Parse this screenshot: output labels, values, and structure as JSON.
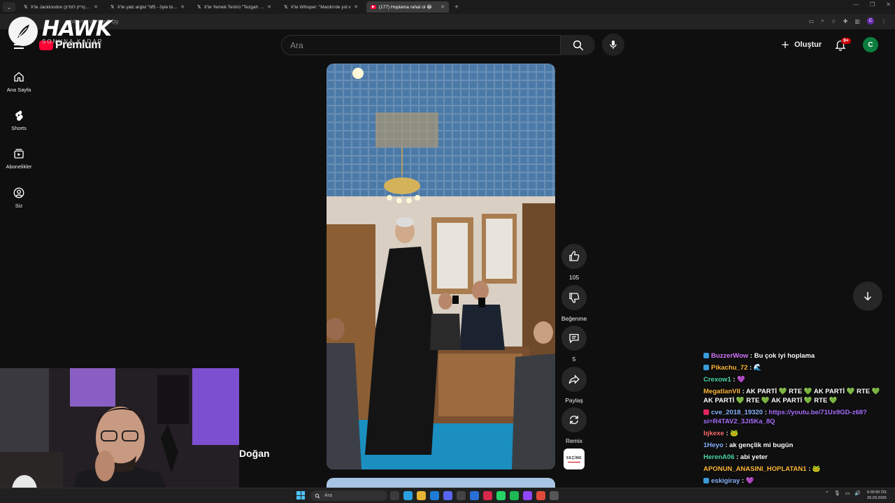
{
  "browser": {
    "tabs": [
      {
        "icon": "x-icon",
        "title": "X'te Jacklondon (גייק לונדון) \"Xag",
        "active": false
      },
      {
        "icon": "x-icon",
        "title": "X'te yalc argivi \"bf5 - öyle bi an",
        "active": false
      },
      {
        "icon": "x-icon",
        "title": "X'te Yemek Terörü \"Tezgah ter",
        "active": false
      },
      {
        "icon": "x-icon",
        "title": "X'te Whisper: \"Mardin'de yol v",
        "active": false
      },
      {
        "icon": "youtube-icon",
        "title": "(177) Hoplama rahat ol 😂",
        "active": true
      }
    ],
    "url": "/shorts/-VE-Wedi-Qg",
    "profile_initial": "C"
  },
  "overlay": {
    "logo_name": "HAWK",
    "logo_subtitle": "SONUNA KADAR",
    "channel_name_partial": "Doğan"
  },
  "youtube": {
    "logo_text": "Premium",
    "search_placeholder": "Ara",
    "create_label": "Oluştur",
    "notification_count": "9+",
    "avatar_initial": "C",
    "guide": [
      {
        "icon": "home-icon",
        "label": "Ana Sayfa"
      },
      {
        "icon": "shorts-icon",
        "label": "Shorts"
      },
      {
        "icon": "subscriptions-icon",
        "label": "Abonelikler"
      },
      {
        "icon": "you-icon",
        "label": "Siz"
      }
    ],
    "actions": {
      "like_count": "105",
      "dislike_label": "Beğenme",
      "comment_count": "5",
      "share_label": "Paylaş",
      "remix_label": "Remix",
      "sound_thumb_text": "SEÇİME"
    }
  },
  "chat": [
    {
      "badge_color": "#3a9bd9",
      "user": "BuzzerWow",
      "user_color": "#d679ff",
      "message": ": Bu çok iyi hoplama",
      "link": false
    },
    {
      "badge_color": "#3a9bd9",
      "user": "Pikachu_72",
      "user_color": "#ffb83a",
      "message": ": 🌊",
      "link": false
    },
    {
      "badge_color": "",
      "user": "Crexow1",
      "user_color": "#4dd9a7",
      "message": ": 💜",
      "link": false
    },
    {
      "badge_color": "",
      "user": "MegatlanVII",
      "user_color": "#ffb83a",
      "message": ": AK PARTİ 💚 RTE 💚 AK PARTİ 💚 RTE 💚 AK PARTİ 💚 RTE 💚 AK PARTİ 💚 RTE 💚",
      "link": false
    },
    {
      "badge_color": "#e0245e",
      "user": "cve_2018_19320",
      "user_color": "#8ab4ff",
      "message": "https://youtu.be/71Ux9GD-z68?si=R4TAV2_3Ji5Ka_8Q",
      "link": true
    },
    {
      "badge_color": "",
      "user": "bjkexe",
      "user_color": "#ff6f6f",
      "message": ": 🐸",
      "link": false
    },
    {
      "badge_color": "",
      "user": "1Heyo",
      "user_color": "#8ab4ff",
      "message": ": ak gençlik mi bugün",
      "link": false
    },
    {
      "badge_color": "",
      "user": "HerenA06",
      "user_color": "#4dd9a7",
      "message": ": abi yeter",
      "link": false
    },
    {
      "badge_color": "",
      "user": "APONUN_ANASINI_HOPLATAN1",
      "user_color": "#ffb83a",
      "message": ": 🐸",
      "link": false
    },
    {
      "badge_color": "#3a9bd9",
      "user": "eskigiray",
      "user_color": "#8ab4ff",
      "message": ": 💜",
      "link": false
    }
  ],
  "taskbar": {
    "search_placeholder": "Ara",
    "time": "5:00:50 ÖS",
    "date": "26.03.2026"
  },
  "colors": {
    "accent_red": "#ff0033",
    "avatar_green": "#0b7d3e",
    "background": "#0f0f0f"
  }
}
